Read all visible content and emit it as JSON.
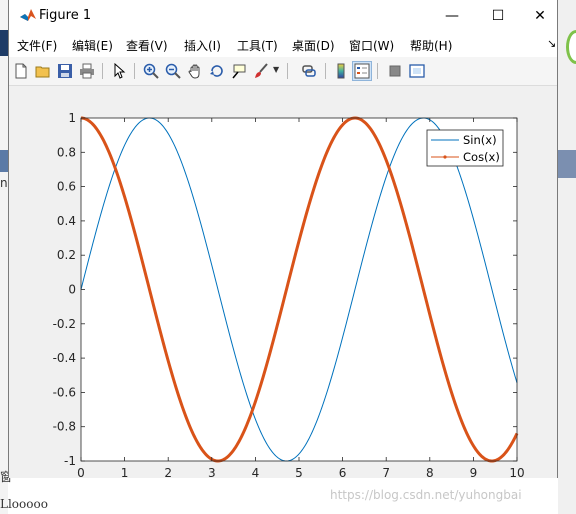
{
  "window": {
    "title": "Figure 1",
    "controls": {
      "minimize": "—",
      "maximize": "☐",
      "close": "✕"
    }
  },
  "menu": [
    "文件(F)",
    "编辑(E)",
    "查看(V)",
    "插入(I)",
    "工具(T)",
    "桌面(D)",
    "窗口(W)",
    "帮助(H)"
  ],
  "toolbar": {
    "icons": [
      "new-figure-icon",
      "open-icon",
      "save-icon",
      "print-icon",
      "pointer-icon",
      "zoom-in-icon",
      "zoom-out-icon",
      "pan-hand-icon",
      "rotate-3d-icon",
      "data-cursor-icon",
      "brush-icon",
      "link-icon",
      "colorbar-icon",
      "legend-icon",
      "hide-plot-tools-icon",
      "show-plot-tools-icon"
    ]
  },
  "background_fragments": {
    "left_mid": "nt",
    "left_lower": "窗",
    "bottom": "Llooooo"
  },
  "watermark": "https://blog.csdn.net/yuhongbai",
  "chart_data": {
    "type": "line",
    "title": "",
    "xlabel": "",
    "ylabel": "",
    "xlim": [
      0,
      10
    ],
    "ylim": [
      -1,
      1
    ],
    "xticks": [
      "0",
      "1",
      "2",
      "3",
      "4",
      "5",
      "6",
      "7",
      "8",
      "9",
      "10"
    ],
    "yticks": [
      "-1",
      "-0.8",
      "-0.6",
      "-0.4",
      "-0.2",
      "0",
      "0.2",
      "0.4",
      "0.6",
      "0.8",
      "1"
    ],
    "grid": false,
    "legend_position": "top-right",
    "series": [
      {
        "name": "Sin(x)",
        "function": "sin(x)",
        "x_range": [
          0,
          10
        ],
        "color": "#0072BD",
        "line": "thin"
      },
      {
        "name": "Cos(x)",
        "function": "cos(x)",
        "x_range": [
          0,
          10
        ],
        "color": "#D95319",
        "line": "thick",
        "marker": "dot-in-legend"
      }
    ]
  }
}
